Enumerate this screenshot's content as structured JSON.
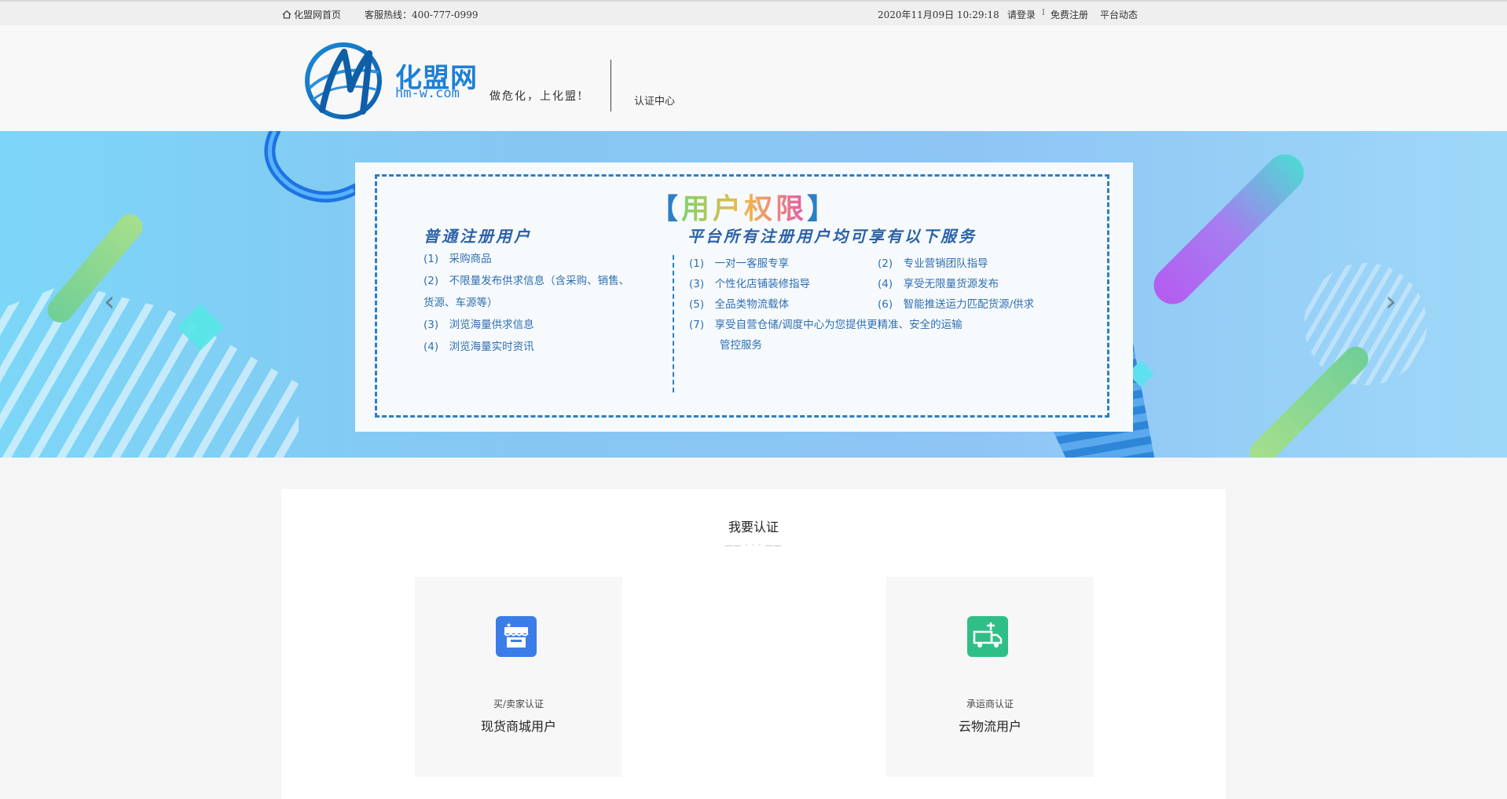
{
  "topbar": {
    "home": "化盟网首页",
    "hotline": "客服热线：400-777-0999",
    "datetime": "2020年11月09日 10:29:18",
    "login": "请登录",
    "separator": "I",
    "register": "免费注册",
    "news": "平台动态"
  },
  "header": {
    "brand": "化盟网",
    "domain": "hm-w.com",
    "slogan": "做危化，上化盟!",
    "center_link": "认证中心"
  },
  "banner": {
    "title_left": "【",
    "title_text": "用户权限",
    "title_right": "】",
    "left_heading": "普通注册用户",
    "left_items": [
      "(1)　采购商品",
      "(2)　不限量发布供求信息（含采购、销售、",
      "货源、车源等）",
      "(3)　浏览海量供求信息",
      "(4)　浏览海量实时资讯"
    ],
    "right_heading": "平台所有注册用户均可享有以下服务",
    "right_items": [
      "(1)　一对一客服专享",
      "(2)　专业营销团队指导",
      "(3)　个性化店铺装修指导",
      "(4)　享受无限量货源发布",
      "(5)　全品类物流载体",
      "(6)　智能推送运力匹配货源/供求",
      "(7)　享受自营仓储/调度中心为您提供更精准、安全的运输",
      "管控服务"
    ],
    "prev": "‹",
    "next": "›"
  },
  "certify": {
    "title": "我要认证",
    "divider": "—— · · · ——",
    "cards": [
      {
        "sub": "买/卖家认证",
        "main": "现货商城用户",
        "icon": "store-icon",
        "color": "#3b7de8"
      },
      {
        "sub": "承运商认证",
        "main": "云物流用户",
        "icon": "truck-icon",
        "color": "#2fbf86"
      }
    ]
  }
}
